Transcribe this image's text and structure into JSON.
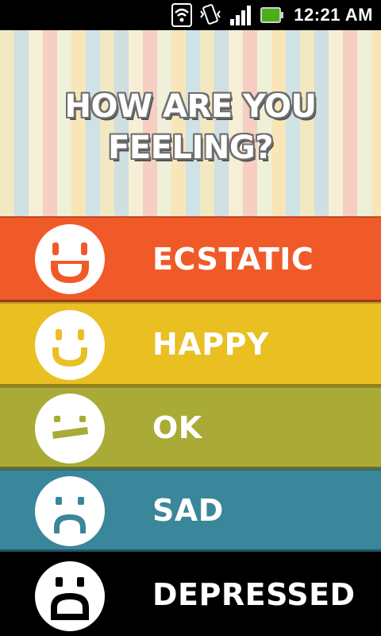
{
  "status_bar": {
    "time": "12:21 AM",
    "icons": [
      "wifi-icon",
      "vibrate-icon",
      "signal-icon",
      "battery-icon"
    ]
  },
  "header": {
    "question_line1": "HOW ARE YOU",
    "question_line2": "FEELING?"
  },
  "moods": [
    {
      "label": "ECSTATIC",
      "color": "#f05a28",
      "face": "ecstatic-face-icon"
    },
    {
      "label": "HAPPY",
      "color": "#e9bf22",
      "face": "happy-face-icon"
    },
    {
      "label": "OK",
      "color": "#a9ab36",
      "face": "ok-face-icon"
    },
    {
      "label": "SAD",
      "color": "#3a869b",
      "face": "sad-face-icon"
    },
    {
      "label": "DEPRESSED",
      "color": "#000000",
      "face": "depressed-face-icon"
    }
  ]
}
